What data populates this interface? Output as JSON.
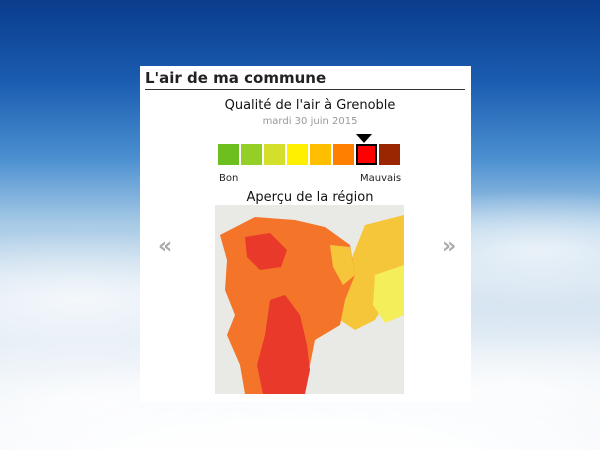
{
  "widget": {
    "title": "L'air de ma commune",
    "city_title": "Qualité de l'air à Grenoble",
    "date": "mardi 30 juin 2015",
    "scale": {
      "colors": [
        "#6cbf1f",
        "#93cf24",
        "#d3df2a",
        "#fff000",
        "#ffbf00",
        "#ff7f00",
        "#ff0000",
        "#992600"
      ],
      "selected_index": 6,
      "label_good": "Bon",
      "label_bad": "Mauvais"
    },
    "region_title": "Aperçu de la région",
    "nav": {
      "prev": "«",
      "next": "»"
    }
  },
  "map_colors": {
    "base": "#ececec",
    "orange": "#f4752a",
    "red": "#e8392a",
    "yellow": "#f6c63a",
    "light_yellow": "#f3ee5a"
  }
}
